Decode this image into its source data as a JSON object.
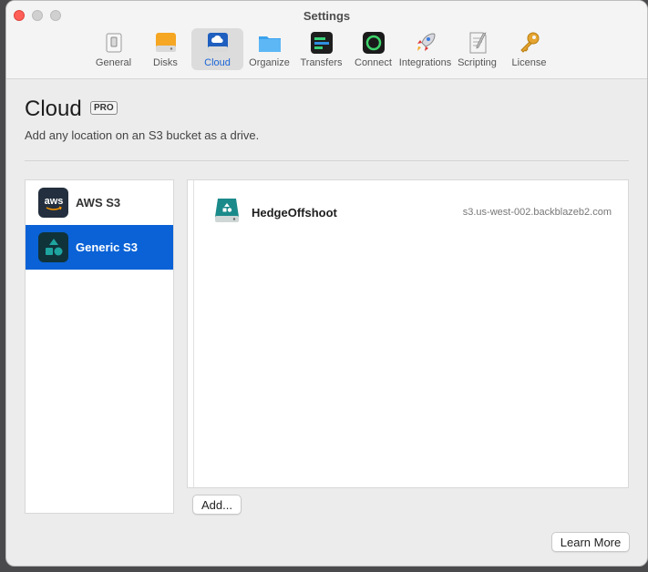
{
  "window": {
    "title": "Settings"
  },
  "toolbar": {
    "items": [
      {
        "label": "General",
        "icon": "switch-icon"
      },
      {
        "label": "Disks",
        "icon": "disk-icon"
      },
      {
        "label": "Cloud",
        "icon": "cloud-icon"
      },
      {
        "label": "Organize",
        "icon": "folder-icon"
      },
      {
        "label": "Transfers",
        "icon": "transfers-icon"
      },
      {
        "label": "Connect",
        "icon": "connect-icon"
      },
      {
        "label": "Integrations",
        "icon": "rocket-icon"
      },
      {
        "label": "Scripting",
        "icon": "script-icon"
      },
      {
        "label": "License",
        "icon": "key-icon"
      }
    ],
    "active_label": "Cloud"
  },
  "page": {
    "title": "Cloud",
    "badge": "PRO",
    "subtitle": "Add any location on an S3 bucket as a drive."
  },
  "sidebar": {
    "items": [
      {
        "label": "AWS S3",
        "icon": "aws-icon",
        "icon_text": "aws"
      },
      {
        "label": "Generic S3",
        "icon": "generic-s3-icon"
      }
    ],
    "selected_label": "Generic S3"
  },
  "drives": [
    {
      "name": "HedgeOffshoot",
      "host": "s3.us-west-002.backblazeb2.com",
      "icon": "cloud-drive-icon"
    }
  ],
  "buttons": {
    "add": "Add...",
    "learn_more": "Learn More"
  },
  "colors": {
    "accent": "#0a62d6",
    "close": "#ff5f57"
  }
}
